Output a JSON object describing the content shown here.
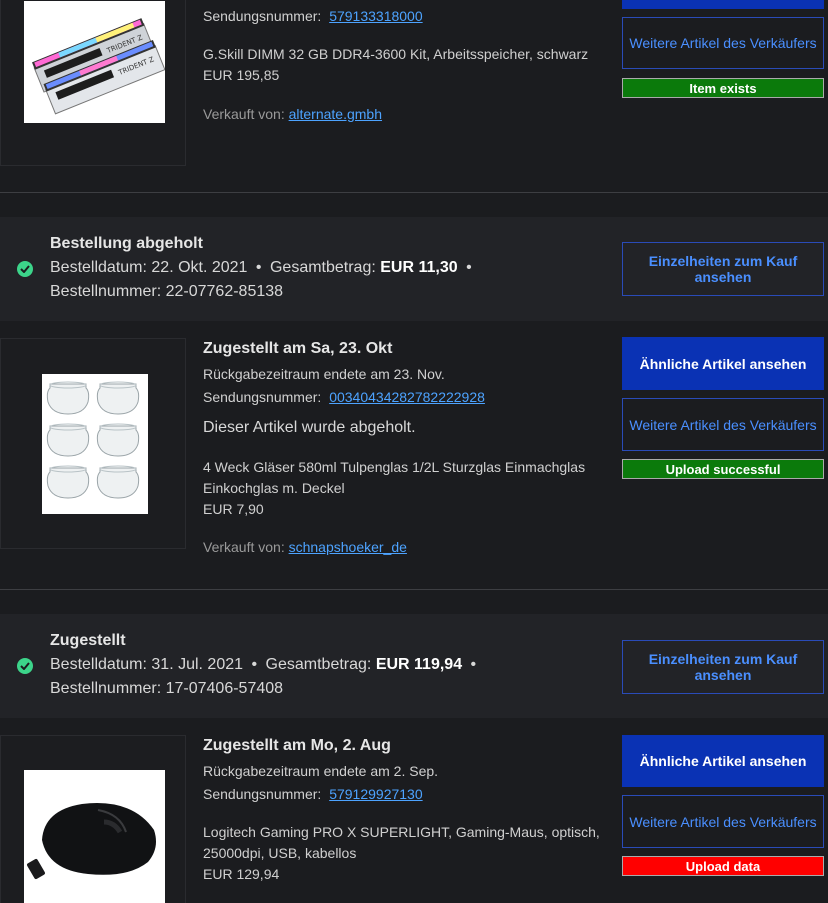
{
  "order0": {
    "tracking_label": "Sendungsnummer:",
    "tracking_number": "579133318000",
    "product": "G.Skill DIMM 32 GB DDR4-3600 Kit, Arbeitsspeicher, schwarz",
    "price": "EUR 195,85",
    "seller_label": "Verkauft von:",
    "seller": "alternate.gmbh",
    "btn_more": "Weitere Artikel des Verkäufers",
    "status": "Item exists",
    "status_color": "#0b7a0b"
  },
  "order1": {
    "status_title": "Bestellung abgeholt",
    "date_label": "Bestelldatum:",
    "date": "22. Okt. 2021",
    "total_label": "Gesamtbetrag:",
    "total": "EUR 11,30",
    "order_label": "Bestellnummer:",
    "order_number": "22-07762-85138",
    "btn_details": "Einzelheiten zum Kauf ansehen",
    "delivered": "Zugestellt am Sa, 23. Okt",
    "return_note": "Rückgabezeitraum endete am 23. Nov.",
    "tracking_label": "Sendungsnummer:",
    "tracking_number": "00340434282782222928",
    "pickup_note": "Dieser Artikel wurde abgeholt.",
    "product_line1": "4 Weck Gläser 580ml Tulpenglas 1/2L Sturzglas Einmachglas",
    "product_line2": "Einkochglas m. Deckel",
    "price": "EUR 7,90",
    "seller_label": "Verkauft von:",
    "seller": "schnapshoeker_de",
    "btn_similar": "Ähnliche Artikel ansehen",
    "btn_more": "Weitere Artikel des Verkäufers",
    "status": "Upload successful",
    "status_color": "#0b7a0b"
  },
  "order2": {
    "status_title": "Zugestellt",
    "date_label": "Bestelldatum:",
    "date": "31. Jul. 2021",
    "total_label": "Gesamtbetrag:",
    "total": "EUR 119,94",
    "order_label": "Bestellnummer:",
    "order_number": "17-07406-57408",
    "btn_details": "Einzelheiten zum Kauf ansehen",
    "delivered": "Zugestellt am Mo, 2. Aug",
    "return_note": "Rückgabezeitraum endete am 2. Sep.",
    "tracking_label": "Sendungsnummer:",
    "tracking_number": "579129927130",
    "product_line1": "Logitech Gaming PRO X SUPERLIGHT, Gaming-Maus, optisch,",
    "product_line2": "25000dpi, USB, kabellos",
    "price": "EUR 129,94",
    "btn_similar": "Ähnliche Artikel ansehen",
    "btn_more": "Weitere Artikel des Verkäufers",
    "status": "Upload data",
    "status_color": "#ff0000"
  },
  "separator": "•",
  "icons": {
    "check": "check-circle-icon"
  }
}
